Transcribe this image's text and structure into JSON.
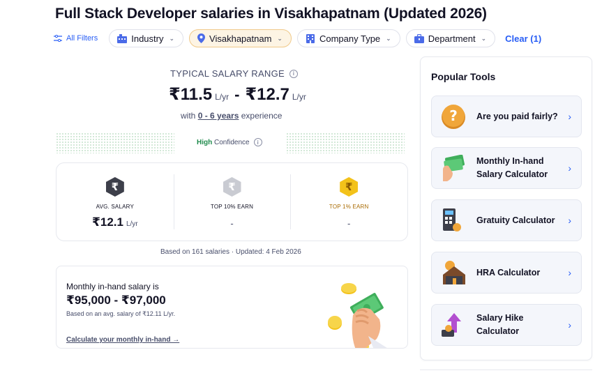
{
  "page": {
    "title": "Full Stack Developer salaries in Visakhapatnam (Updated 2026)"
  },
  "filters": {
    "all_filters": "All Filters",
    "chips": [
      {
        "label": "Industry",
        "icon": "building-icon"
      },
      {
        "label": "Visakhapatnam",
        "icon": "location-pin-icon",
        "active": true
      },
      {
        "label": "Company Type",
        "icon": "office-icon"
      },
      {
        "label": "Department",
        "icon": "briefcase-icon"
      }
    ],
    "clear": "Clear (1)"
  },
  "salary_range": {
    "label": "TYPICAL SALARY RANGE",
    "min": "₹11.5",
    "max": "₹12.7",
    "unit": "L/yr",
    "separator": "-",
    "experience_prefix": "with",
    "experience_years": "0 - 6 years",
    "experience_suffix": "experience",
    "confidence_high": "High",
    "confidence_label": "Confidence"
  },
  "stats": {
    "avg": {
      "label": "AVG. SALARY",
      "value": "₹12.1",
      "unit": "L/yr",
      "icon": "₹"
    },
    "top10": {
      "label": "TOP 10% EARN",
      "value": "-",
      "icon": "₹"
    },
    "top1": {
      "label": "TOP 1% EARN",
      "value": "-",
      "icon": "₹"
    }
  },
  "based_on": "Based on 161 salaries · Updated: 4 Feb 2026",
  "inhand": {
    "title": "Monthly in-hand salary is",
    "value": "₹95,000 - ₹97,000",
    "sub": "Based on an avg. salary of ₹12.11 L/yr.",
    "link": "Calculate your monthly in-hand →"
  },
  "tools": {
    "heading": "Popular Tools",
    "items": [
      {
        "label": "Are you paid fairly?",
        "icon": "question-coin-icon"
      },
      {
        "label": "Monthly In-hand Salary Calculator",
        "icon": "cash-hand-icon"
      },
      {
        "label": "Gratuity Calculator",
        "icon": "calculator-icon"
      },
      {
        "label": "HRA Calculator",
        "icon": "house-coin-icon"
      },
      {
        "label": "Salary Hike Calculator",
        "icon": "growth-arrow-icon"
      }
    ]
  },
  "colors": {
    "accent": "#275df5",
    "confidence": "#1f8a4c",
    "gold": "#f3c21a"
  }
}
